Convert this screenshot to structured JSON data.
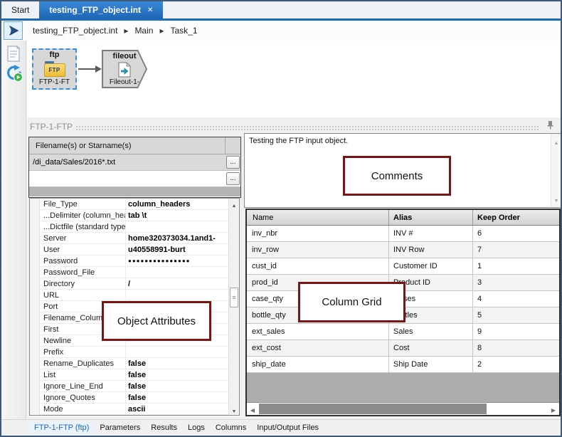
{
  "tabs": [
    {
      "label": "Start"
    },
    {
      "label": "testing_FTP_object.int"
    }
  ],
  "breadcrumb": {
    "items": [
      "testing_FTP_object.int",
      "Main",
      "Task_1"
    ]
  },
  "canvas": {
    "nodes": [
      {
        "type_label": "ftp",
        "icon_text": "FTP",
        "name_label": "FTP-1-FT",
        "selected": true
      },
      {
        "type_label": "fileout",
        "name_label": "Fileout-1-",
        "selected": false
      }
    ]
  },
  "panel": {
    "title": "FTP-1-FTP",
    "filenames": {
      "header": "Filename(s) or Starname(s)",
      "rows": [
        {
          "value": "/di_data/Sales/2016*.txt",
          "button_label": "..."
        },
        {
          "value": "",
          "button_label": "..."
        }
      ]
    },
    "attributes": [
      {
        "name": "File_Type",
        "value": "column_headers"
      },
      {
        "name": "...Delimiter (column_hea",
        "value": "tab \\t"
      },
      {
        "name": "...Dictfile (standard type",
        "value": ""
      },
      {
        "name": "Server",
        "value": "home320373034.1and1-",
        "truncated": true
      },
      {
        "name": "User",
        "value": "u40558991-burt"
      },
      {
        "name": "Password",
        "value": "●●●●●●●●●●●●●●●",
        "masked": true
      },
      {
        "name": "Password_File",
        "value": ""
      },
      {
        "name": "Directory",
        "value": "/"
      },
      {
        "name": "URL",
        "value": ""
      },
      {
        "name": "Port",
        "value": ""
      },
      {
        "name": "Filename_Column",
        "value": ""
      },
      {
        "name": "First",
        "value": ""
      },
      {
        "name": "Newline",
        "value": ""
      },
      {
        "name": "Prefix",
        "value": ""
      },
      {
        "name": "Rename_Duplicates",
        "value": "false"
      },
      {
        "name": "List",
        "value": "false"
      },
      {
        "name": "Ignore_Line_End",
        "value": "false"
      },
      {
        "name": "Ignore_Quotes",
        "value": "false"
      },
      {
        "name": "Mode",
        "value": "ascii"
      }
    ],
    "comments_text": "Testing the FTP input object.",
    "column_grid": {
      "headers": [
        "Name",
        "Alias",
        "Keep Order"
      ],
      "rows": [
        {
          "name": "inv_nbr",
          "alias": "INV #",
          "keep_order": "6"
        },
        {
          "name": "inv_row",
          "alias": "INV Row",
          "keep_order": "7"
        },
        {
          "name": "cust_id",
          "alias": "Customer ID",
          "keep_order": "1"
        },
        {
          "name": "prod_id",
          "alias": "Product ID",
          "keep_order": "3"
        },
        {
          "name": "case_qty",
          "alias": "Cases",
          "keep_order": "4"
        },
        {
          "name": "bottle_qty",
          "alias": "Bottles",
          "keep_order": "5"
        },
        {
          "name": "ext_sales",
          "alias": "Sales",
          "keep_order": "9"
        },
        {
          "name": "ext_cost",
          "alias": "Cost",
          "keep_order": "8"
        },
        {
          "name": "ship_date",
          "alias": "Ship Date",
          "keep_order": "2"
        }
      ]
    }
  },
  "annotations": {
    "comments": "Comments",
    "attributes": "Object Attributes",
    "grid": "Column Grid"
  },
  "bottom_tabs": [
    {
      "label": "FTP-1-FTP (ftp)",
      "active": true
    },
    {
      "label": "Parameters"
    },
    {
      "label": "Results"
    },
    {
      "label": "Logs"
    },
    {
      "label": "Columns"
    },
    {
      "label": "Input/Output Files"
    }
  ],
  "icons": {
    "run": "run-play-icon",
    "notes": "document-notes-icon",
    "history": "run-history-icon",
    "pin": "pin-icon",
    "close": "close-icon"
  },
  "colors": {
    "accent_blue": "#1d6ab8",
    "annotation_red": "#7c1416"
  }
}
